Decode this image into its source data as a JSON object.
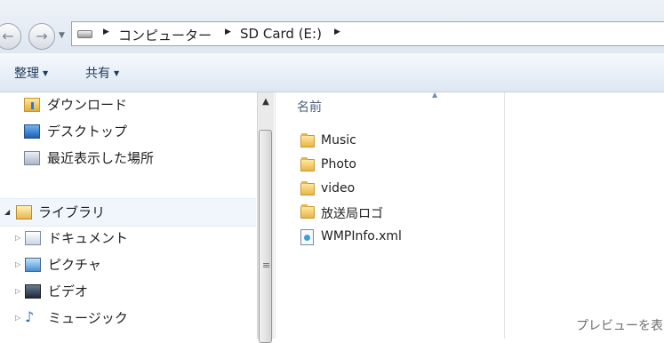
{
  "address_bar": {
    "back_icon": "back-arrow-icon",
    "forward_icon": "forward-arrow-icon",
    "drive_icon": "drive-icon",
    "breadcrumbs": [
      "コンピューター",
      "SD Card (E:)"
    ]
  },
  "toolbar": {
    "organize_label": "整理",
    "share_label": "共有"
  },
  "nav_pane": {
    "favorites": [
      {
        "label": "ダウンロード",
        "icon": "downloads-folder-icon"
      },
      {
        "label": "デスクトップ",
        "icon": "desktop-icon"
      },
      {
        "label": "最近表示した場所",
        "icon": "recent-places-icon"
      }
    ],
    "library": {
      "label": "ライブラリ",
      "icon": "library-icon"
    },
    "library_items": [
      {
        "label": "ドキュメント",
        "icon": "documents-icon"
      },
      {
        "label": "ピクチャ",
        "icon": "pictures-icon"
      },
      {
        "label": "ビデオ",
        "icon": "videos-icon"
      },
      {
        "label": "ミュージック",
        "icon": "music-icon"
      }
    ]
  },
  "file_list": {
    "column_header": "名前",
    "items": [
      {
        "name": "Music",
        "type": "folder"
      },
      {
        "name": "Photo",
        "type": "folder"
      },
      {
        "name": "video",
        "type": "folder"
      },
      {
        "name": "放送局ロゴ",
        "type": "folder"
      },
      {
        "name": "WMPInfo.xml",
        "type": "xml"
      }
    ]
  },
  "preview_pane": {
    "text": "プレビューを表"
  }
}
